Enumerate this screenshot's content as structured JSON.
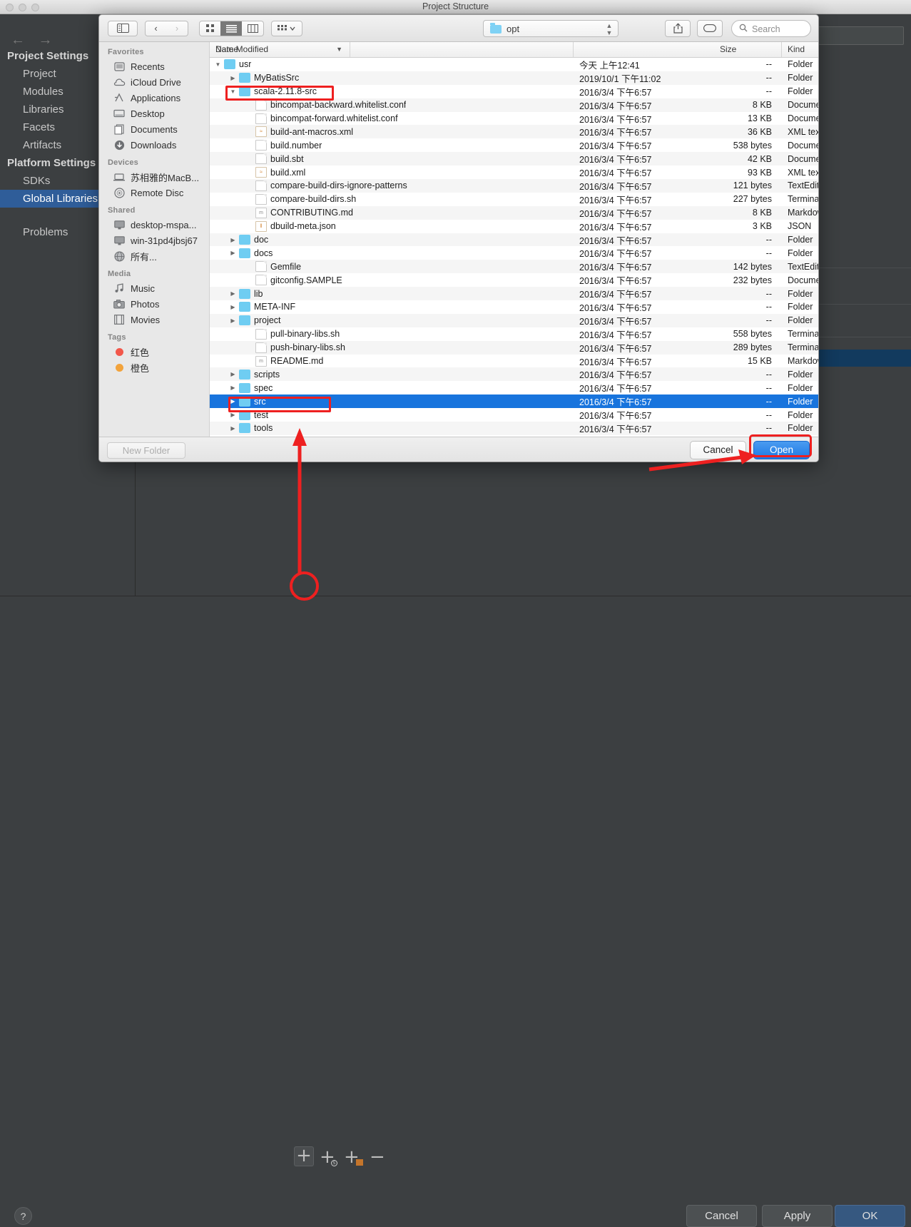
{
  "background_window": {
    "title": "Project Structure",
    "traffic_lights": [
      "close",
      "minimize",
      "maximize"
    ],
    "nav": {
      "back": "←",
      "forward": "→"
    },
    "sidebar": {
      "groups": [
        {
          "label": "Project Settings",
          "items": [
            "Project",
            "Modules",
            "Libraries",
            "Facets",
            "Artifacts"
          ]
        },
        {
          "label": "Platform Settings",
          "items": [
            "SDKs",
            "Global Libraries"
          ]
        }
      ],
      "selected_item": "Global Libraries",
      "standalone": "Problems"
    },
    "toolbar_buttons": [
      {
        "name": "add",
        "label": "+"
      },
      {
        "name": "add-scala-sdk",
        "label": "+"
      },
      {
        "name": "add-java",
        "label": "+"
      },
      {
        "name": "remove",
        "label": "−"
      }
    ],
    "footer": {
      "help": "?",
      "cancel": "Cancel",
      "apply": "Apply",
      "ok": "OK"
    }
  },
  "finder": {
    "toolbar": {
      "sidebar_toggle_icon": "sidebar-toggle-icon",
      "back_label": "‹",
      "forward_label": "›",
      "view_icon_label": "icon-view",
      "view_list_label": "list-view",
      "view_column_label": "column-view",
      "arrange_label": "arrange",
      "path_value": "opt",
      "share_label": "share",
      "tag_label": "tag",
      "search_placeholder": "Search"
    },
    "sidebar": [
      {
        "heading": "Favorites",
        "items": [
          {
            "label": "Recents",
            "icon": "recents-icon"
          },
          {
            "label": "iCloud Drive",
            "icon": "icloud-icon"
          },
          {
            "label": "Applications",
            "icon": "applications-icon"
          },
          {
            "label": "Desktop",
            "icon": "desktop-icon"
          },
          {
            "label": "Documents",
            "icon": "documents-icon"
          },
          {
            "label": "Downloads",
            "icon": "downloads-icon"
          }
        ]
      },
      {
        "heading": "Devices",
        "items": [
          {
            "label": "苏相雅的MacB...",
            "icon": "laptop-icon"
          },
          {
            "label": "Remote Disc",
            "icon": "disc-icon"
          }
        ]
      },
      {
        "heading": "Shared",
        "items": [
          {
            "label": "desktop-mspa...",
            "icon": "monitor-icon"
          },
          {
            "label": "win-31pd4jbsj67",
            "icon": "monitor-icon"
          },
          {
            "label": "所有...",
            "icon": "globe-icon"
          }
        ]
      },
      {
        "heading": "Media",
        "items": [
          {
            "label": "Music",
            "icon": "music-icon"
          },
          {
            "label": "Photos",
            "icon": "photos-icon"
          },
          {
            "label": "Movies",
            "icon": "movies-icon"
          }
        ]
      },
      {
        "heading": "Tags",
        "items": [
          {
            "label": "红色",
            "icon": "tag-dot",
            "color": "#f2574a"
          },
          {
            "label": "橙色",
            "icon": "tag-dot",
            "color": "#f2a33c"
          }
        ]
      }
    ],
    "columns": [
      "Name",
      "Date Modified",
      "Size",
      "Kind"
    ],
    "sort_column": "Date Modified",
    "rows": [
      {
        "name": "usr",
        "indent": 0,
        "twisty": "down",
        "icon": "folder",
        "date": "今天 上午12:41",
        "size": "--",
        "kind": "Folder"
      },
      {
        "name": "MyBatisSrc",
        "indent": 1,
        "twisty": "right",
        "icon": "folder",
        "date": "2019/10/1 下午11:02",
        "size": "--",
        "kind": "Folder"
      },
      {
        "name": "scala-2.11.8-src",
        "indent": 1,
        "twisty": "down",
        "icon": "folder",
        "date": "2016/3/4 下午6:57",
        "size": "--",
        "kind": "Folder"
      },
      {
        "name": "bincompat-backward.whitelist.conf",
        "indent": 2,
        "twisty": "",
        "icon": "doc",
        "date": "2016/3/4 下午6:57",
        "size": "8 KB",
        "kind": "Document"
      },
      {
        "name": "bincompat-forward.whitelist.conf",
        "indent": 2,
        "twisty": "",
        "icon": "doc",
        "date": "2016/3/4 下午6:57",
        "size": "13 KB",
        "kind": "Document"
      },
      {
        "name": "build-ant-macros.xml",
        "indent": 2,
        "twisty": "",
        "icon": "xml",
        "date": "2016/3/4 下午6:57",
        "size": "36 KB",
        "kind": "XML text"
      },
      {
        "name": "build.number",
        "indent": 2,
        "twisty": "",
        "icon": "doc",
        "date": "2016/3/4 下午6:57",
        "size": "538 bytes",
        "kind": "Document"
      },
      {
        "name": "build.sbt",
        "indent": 2,
        "twisty": "",
        "icon": "doc",
        "date": "2016/3/4 下午6:57",
        "size": "42 KB",
        "kind": "Document"
      },
      {
        "name": "build.xml",
        "indent": 2,
        "twisty": "",
        "icon": "xml",
        "date": "2016/3/4 下午6:57",
        "size": "93 KB",
        "kind": "XML text"
      },
      {
        "name": "compare-build-dirs-ignore-patterns",
        "indent": 2,
        "twisty": "",
        "icon": "doc",
        "date": "2016/3/4 下午6:57",
        "size": "121 bytes",
        "kind": "TextEdit"
      },
      {
        "name": "compare-build-dirs.sh",
        "indent": 2,
        "twisty": "",
        "icon": "doc",
        "date": "2016/3/4 下午6:57",
        "size": "227 bytes",
        "kind": "Terminal s"
      },
      {
        "name": "CONTRIBUTING.md",
        "indent": 2,
        "twisty": "",
        "icon": "md",
        "date": "2016/3/4 下午6:57",
        "size": "8 KB",
        "kind": "Markdown"
      },
      {
        "name": "dbuild-meta.json",
        "indent": 2,
        "twisty": "",
        "icon": "json",
        "date": "2016/3/4 下午6:57",
        "size": "3 KB",
        "kind": "JSON"
      },
      {
        "name": "doc",
        "indent": 1,
        "twisty": "right",
        "icon": "folder",
        "date": "2016/3/4 下午6:57",
        "size": "--",
        "kind": "Folder"
      },
      {
        "name": "docs",
        "indent": 1,
        "twisty": "right",
        "icon": "folder",
        "date": "2016/3/4 下午6:57",
        "size": "--",
        "kind": "Folder"
      },
      {
        "name": "Gemfile",
        "indent": 2,
        "twisty": "",
        "icon": "doc",
        "date": "2016/3/4 下午6:57",
        "size": "142 bytes",
        "kind": "TextEdit"
      },
      {
        "name": "gitconfig.SAMPLE",
        "indent": 2,
        "twisty": "",
        "icon": "doc",
        "date": "2016/3/4 下午6:57",
        "size": "232 bytes",
        "kind": "Document"
      },
      {
        "name": "lib",
        "indent": 1,
        "twisty": "right",
        "icon": "folder",
        "date": "2016/3/4 下午6:57",
        "size": "--",
        "kind": "Folder"
      },
      {
        "name": "META-INF",
        "indent": 1,
        "twisty": "right",
        "icon": "folder",
        "date": "2016/3/4 下午6:57",
        "size": "--",
        "kind": "Folder"
      },
      {
        "name": "project",
        "indent": 1,
        "twisty": "right",
        "icon": "folder",
        "date": "2016/3/4 下午6:57",
        "size": "--",
        "kind": "Folder"
      },
      {
        "name": "pull-binary-libs.sh",
        "indent": 2,
        "twisty": "",
        "icon": "doc",
        "date": "2016/3/4 下午6:57",
        "size": "558 bytes",
        "kind": "Terminal s"
      },
      {
        "name": "push-binary-libs.sh",
        "indent": 2,
        "twisty": "",
        "icon": "doc",
        "date": "2016/3/4 下午6:57",
        "size": "289 bytes",
        "kind": "Terminal s"
      },
      {
        "name": "README.md",
        "indent": 2,
        "twisty": "",
        "icon": "md",
        "date": "2016/3/4 下午6:57",
        "size": "15 KB",
        "kind": "Markdown"
      },
      {
        "name": "scripts",
        "indent": 1,
        "twisty": "right",
        "icon": "folder",
        "date": "2016/3/4 下午6:57",
        "size": "--",
        "kind": "Folder"
      },
      {
        "name": "spec",
        "indent": 1,
        "twisty": "right",
        "icon": "folder",
        "date": "2016/3/4 下午6:57",
        "size": "--",
        "kind": "Folder"
      },
      {
        "name": "src",
        "indent": 1,
        "twisty": "right",
        "icon": "folder",
        "date": "2016/3/4 下午6:57",
        "size": "--",
        "kind": "Folder",
        "selected": true
      },
      {
        "name": "test",
        "indent": 1,
        "twisty": "right",
        "icon": "folder",
        "date": "2016/3/4 下午6:57",
        "size": "--",
        "kind": "Folder"
      },
      {
        "name": "tools",
        "indent": 1,
        "twisty": "right",
        "icon": "folder",
        "date": "2016/3/4 下午6:57",
        "size": "--",
        "kind": "Folder"
      }
    ],
    "bottom": {
      "new_folder": "New Folder",
      "cancel": "Cancel",
      "open": "Open"
    }
  },
  "annotations": {
    "highlight_color": "#ee2020",
    "boxes": [
      "scala-2.11.8-src",
      "src",
      "Open"
    ],
    "circle": "add-button",
    "arrows": 2
  },
  "colors": {
    "selection_blue": "#1874dd",
    "accent_button": "#1d7ae5",
    "ide_dark": "#3c3f41",
    "ide_selection": "#2f5d99"
  }
}
